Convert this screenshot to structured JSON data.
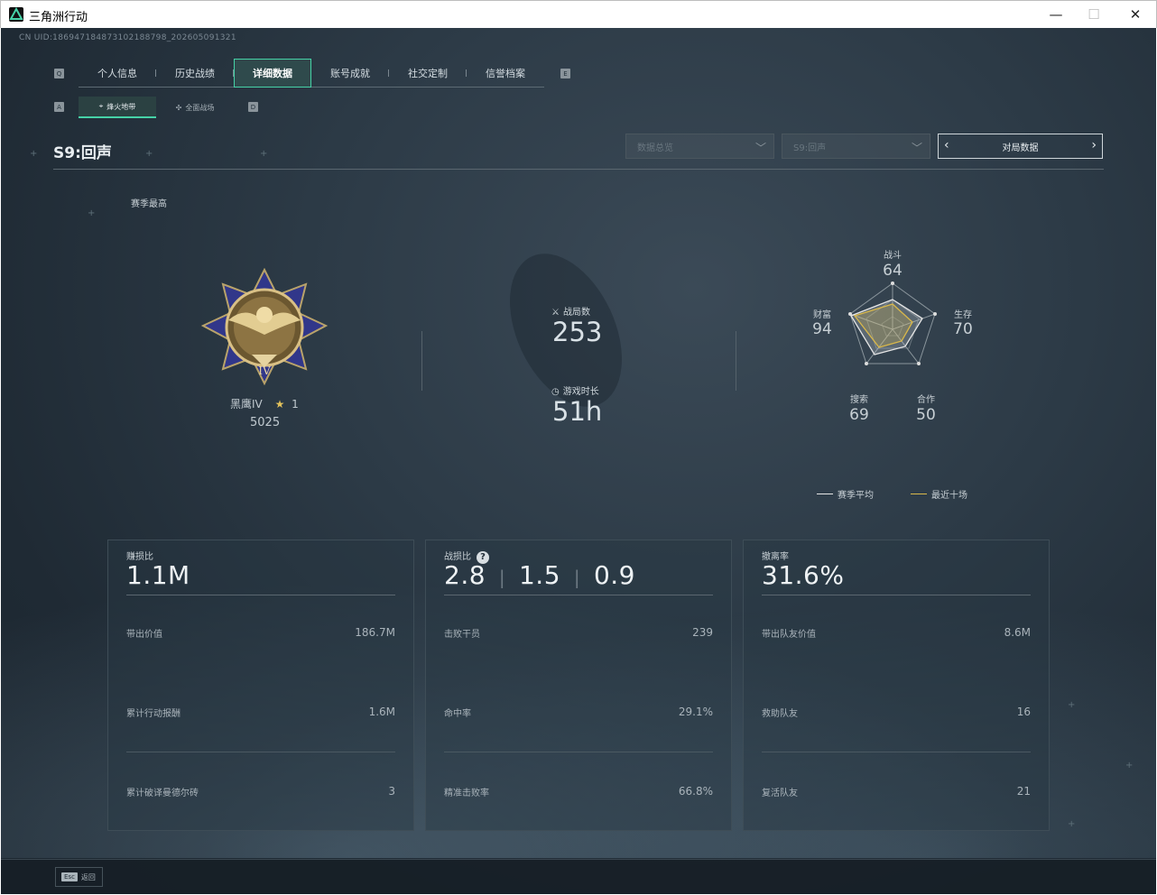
{
  "window": {
    "title": "三角洲行动"
  },
  "uid": "CN UID:1869471848731021887​98_202605091321",
  "tabs": [
    "个人信息",
    "历史战绩",
    "详细数据",
    "账号成就",
    "社交定制",
    "信誉档案"
  ],
  "active_tab": "详细数据",
  "tab_keys": {
    "left": "Q",
    "right": "E"
  },
  "subtabs": [
    "烽火地带",
    "全面战场"
  ],
  "subtab_keys": {
    "left": "A",
    "right": "D"
  },
  "season_title": "S9:回声",
  "dropdowns": {
    "data_type": "数据总览",
    "season": "S9:回声"
  },
  "match_data_label": "对局数据",
  "season_best_label": "赛季最高",
  "rank": {
    "name": "黑鹰IV",
    "stars": "1",
    "score": "5025"
  },
  "matches": {
    "label": "战局数",
    "value": "253"
  },
  "playtime": {
    "label": "游戏时长",
    "value": "51h"
  },
  "radar": {
    "axes": [
      {
        "label": "战斗",
        "value": "64"
      },
      {
        "label": "生存",
        "value": "70"
      },
      {
        "label": "合作",
        "value": "50"
      },
      {
        "label": "搜索",
        "value": "69"
      },
      {
        "label": "财富",
        "value": "94"
      }
    ],
    "legend": {
      "season_avg": "赛季平均",
      "recent10": "最近十场"
    },
    "colors": {
      "season_avg": "#e6e6e6",
      "recent10": "#d9b84a"
    }
  },
  "cards": [
    {
      "title": "赚损比",
      "big": "1.1M",
      "rows": [
        {
          "label": "带出价值",
          "value": "186.7M"
        },
        {
          "label": "累计行动报酬",
          "value": "1.6M"
        },
        {
          "label": "累计破译曼德尔砖",
          "value": "3"
        }
      ]
    },
    {
      "title": "战损比",
      "big_parts": [
        "2.8",
        "1.5",
        "0.9"
      ],
      "help": "?",
      "rows": [
        {
          "label": "击败干员",
          "value": "239"
        },
        {
          "label": "命中率",
          "value": "29.1%"
        },
        {
          "label": "精准击败率",
          "value": "66.8%"
        }
      ]
    },
    {
      "title": "撤离率",
      "big": "31.6%",
      "rows": [
        {
          "label": "带出队友价值",
          "value": "8.6M"
        },
        {
          "label": "救助队友",
          "value": "16"
        },
        {
          "label": "复活队友",
          "value": "21"
        }
      ]
    }
  ],
  "footer": {
    "esc_key": "Esc",
    "esc_label": "返回"
  }
}
